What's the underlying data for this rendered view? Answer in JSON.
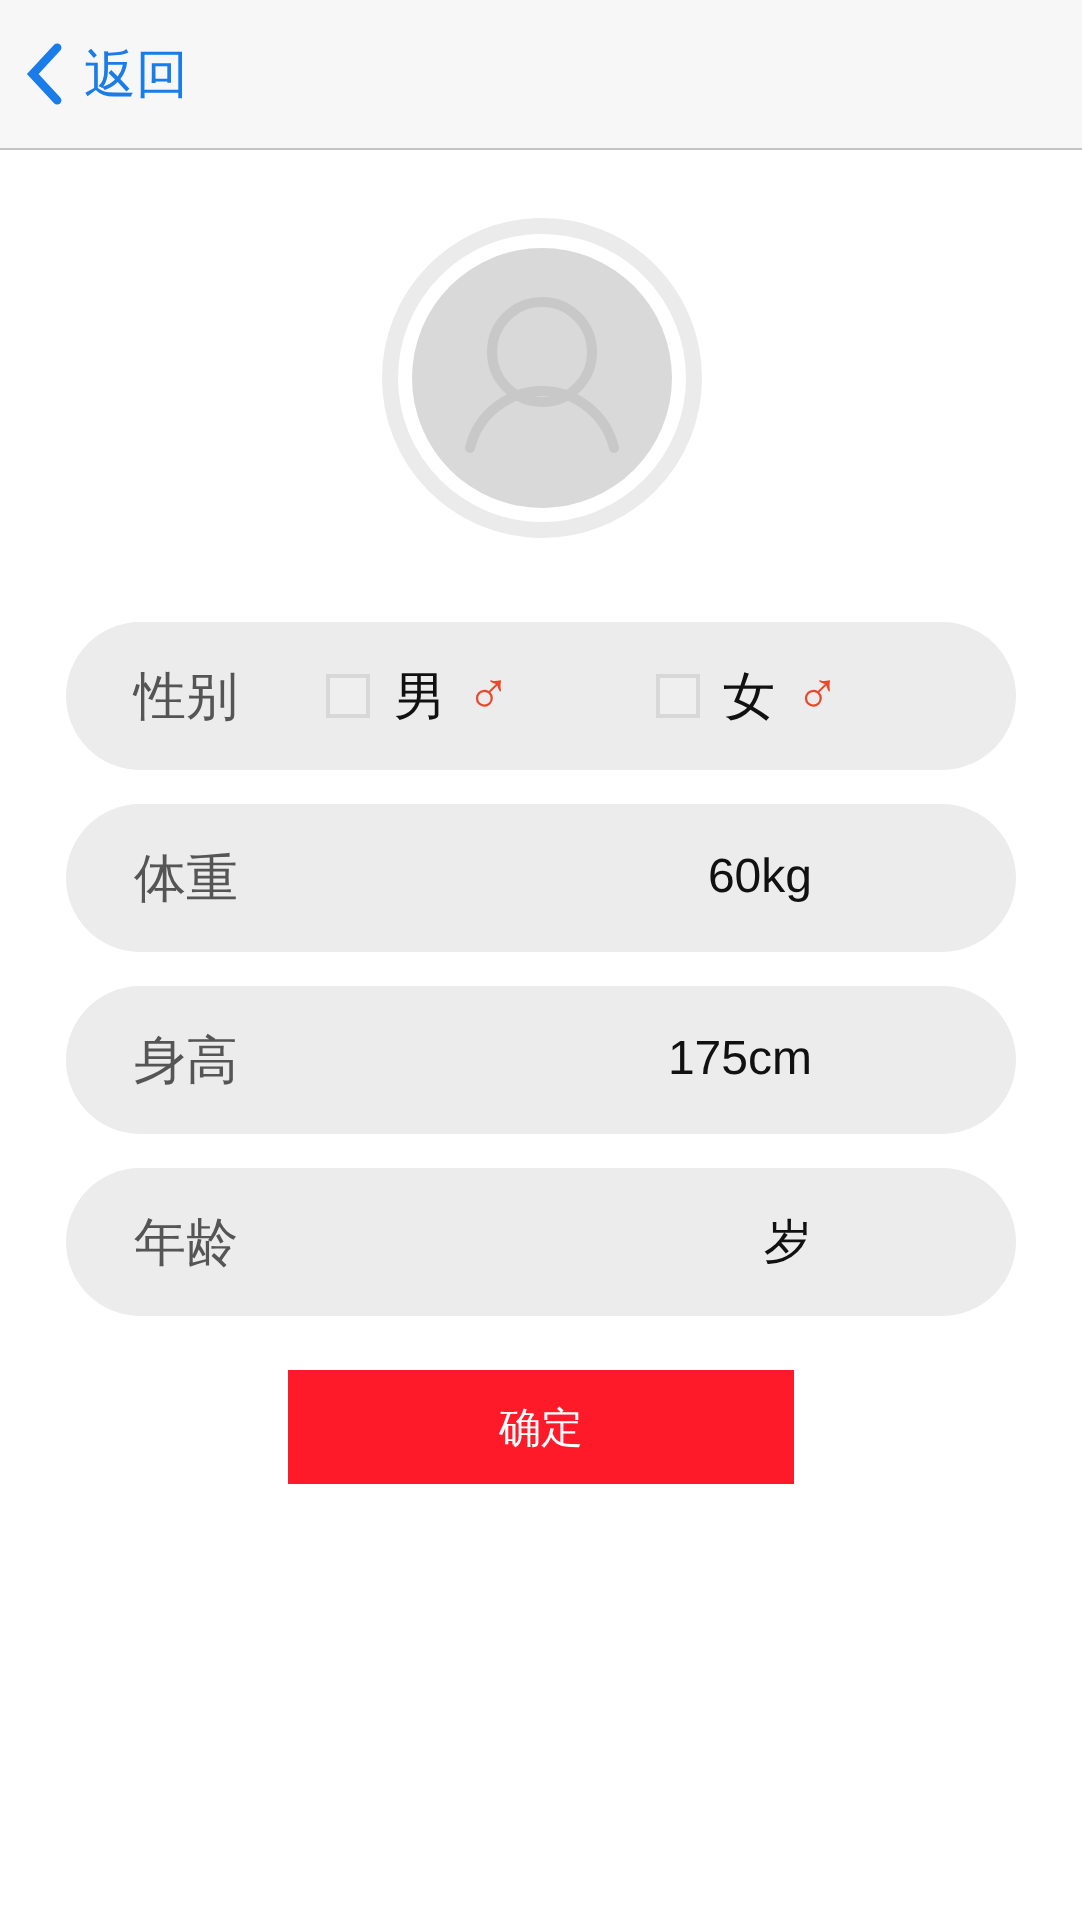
{
  "nav": {
    "back_label": "返回"
  },
  "rows": [
    {
      "kind": "gender",
      "label": "性别",
      "options": [
        {
          "label": "男",
          "symbol": "♂",
          "checked": false
        },
        {
          "label": "女",
          "symbol": "♂",
          "checked": false
        }
      ]
    },
    {
      "kind": "value",
      "label": "体重",
      "value": "60kg"
    },
    {
      "kind": "value",
      "label": "身高",
      "value": "175cm"
    },
    {
      "kind": "value",
      "label": "年龄",
      "value": "岁"
    }
  ],
  "confirm_button": "确定"
}
